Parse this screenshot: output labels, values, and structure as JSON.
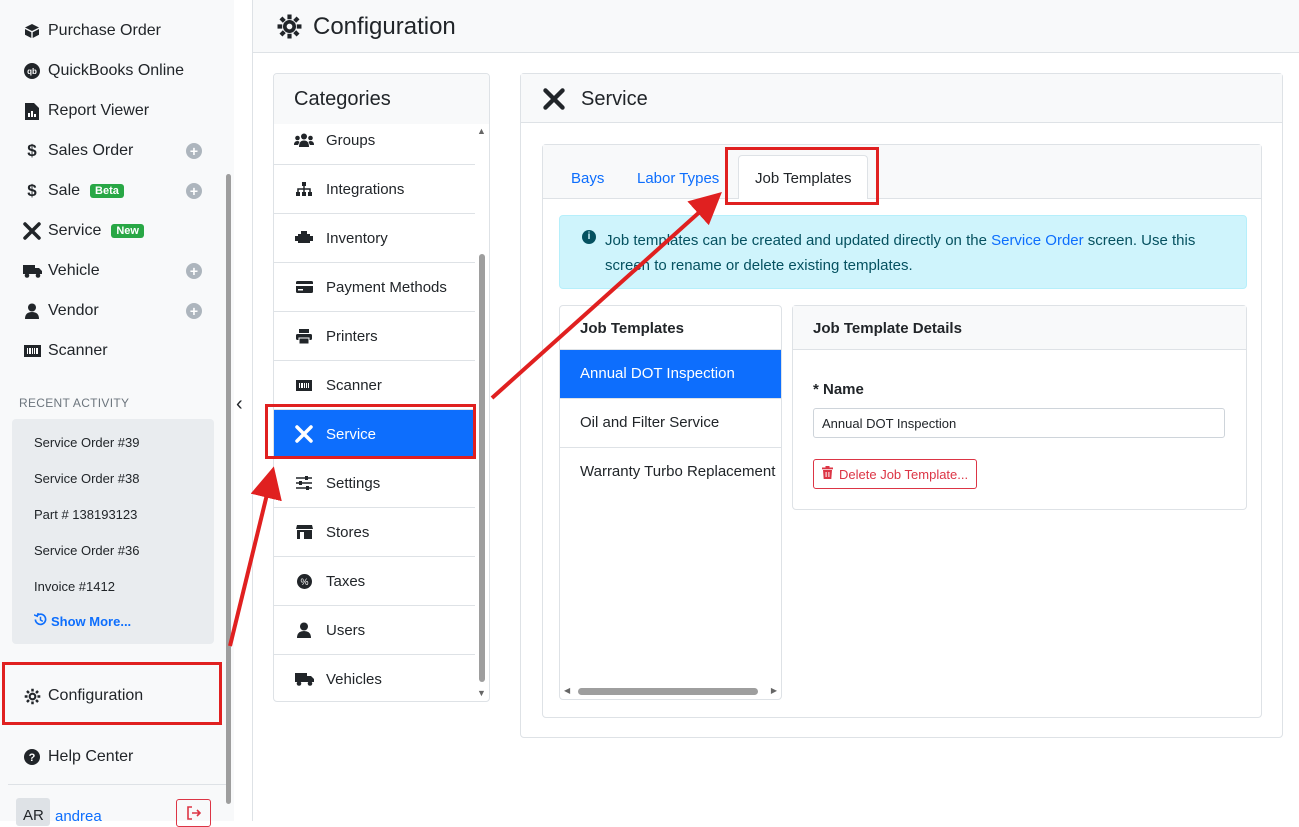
{
  "sidebar": {
    "items": [
      {
        "label": "Purchase Order",
        "icon": "box-icon"
      },
      {
        "label": "QuickBooks Online",
        "icon": "quickbooks-icon"
      },
      {
        "label": "Report Viewer",
        "icon": "report-icon"
      },
      {
        "label": "Sales Order",
        "icon": "dollar-icon"
      },
      {
        "label": "Sale",
        "icon": "dollar-icon",
        "badge": "Beta"
      },
      {
        "label": "Service",
        "icon": "tools-icon",
        "badge": "New"
      },
      {
        "label": "Vehicle",
        "icon": "truck-icon"
      },
      {
        "label": "Vendor",
        "icon": "user-icon"
      },
      {
        "label": "Scanner",
        "icon": "barcode-icon"
      }
    ],
    "recent_title": "RECENT ACTIVITY",
    "recent": [
      "Service Order #39",
      "Service Order #38",
      "Part # 138193123",
      "Service Order #36",
      "Invoice #1412"
    ],
    "show_more": "Show More...",
    "configuration": "Configuration",
    "help": "Help Center",
    "user_initials": "AR",
    "user_name": "andrea"
  },
  "header": {
    "title": "Configuration"
  },
  "categories": {
    "title": "Categories",
    "items": [
      "Groups",
      "Integrations",
      "Inventory",
      "Payment Methods",
      "Printers",
      "Scanner",
      "Service",
      "Settings",
      "Stores",
      "Taxes",
      "Users",
      "Vehicles"
    ],
    "active": "Service"
  },
  "service": {
    "title": "Service",
    "tabs": [
      "Bays",
      "Labor Types",
      "Job Templates"
    ],
    "active_tab": "Job Templates",
    "info_part1": "Job templates can be created and updated directly on the ",
    "info_link": "Service Order",
    "info_part2": " screen. Use this screen to rename or delete existing templates.",
    "list_title": "Job Templates",
    "templates": [
      "Annual DOT Inspection",
      "Oil and Filter Service",
      "Warranty Turbo Replacement"
    ],
    "details_title": "Job Template Details",
    "name_label": "* Name",
    "name_value": "Annual DOT Inspection",
    "delete_label": "Delete Job Template..."
  },
  "colors": {
    "primary": "#0d6efd",
    "highlight": "#e02020",
    "danger": "#dc3545",
    "info_bg": "#cff4fc"
  }
}
